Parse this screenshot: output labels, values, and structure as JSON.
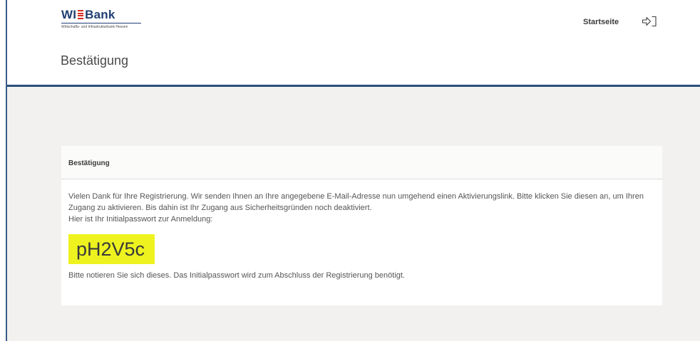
{
  "header": {
    "logo": {
      "left": "WI",
      "right": "Bank",
      "subline": "Wirtschafts- und Infrastrukturbank Hessen"
    },
    "nav": {
      "home_label": "Startseite",
      "login_icon": "login-icon"
    }
  },
  "page": {
    "title": "Bestätigung"
  },
  "panel": {
    "heading": "Bestätigung",
    "paragraph_1": "Vielen Dank für Ihre Registrierung. Wir senden Ihnen an Ihre angegebene E-Mail-Adresse nun umgehend einen Aktivierungslink. Bitte klicken Sie diesen an, um Ihren Zugang zu aktivieren. Bis dahin ist Ihr Zugang aus Sicherheitsgründen noch deaktiviert.",
    "paragraph_2": "Hier ist Ihr Initialpasswort zur Anmeldung:",
    "password": "pH2V5c",
    "note": "Bitte notieren Sie sich dieses. Das Initialpasswort wird zum Abschluss der Registrierung benötigt."
  },
  "colors": {
    "brand_blue": "#1f3e72",
    "brand_red": "#d52b1e",
    "title_rule": "#2c4f7c",
    "highlight": "#eef31f",
    "content_background": "#f2f1ef"
  }
}
